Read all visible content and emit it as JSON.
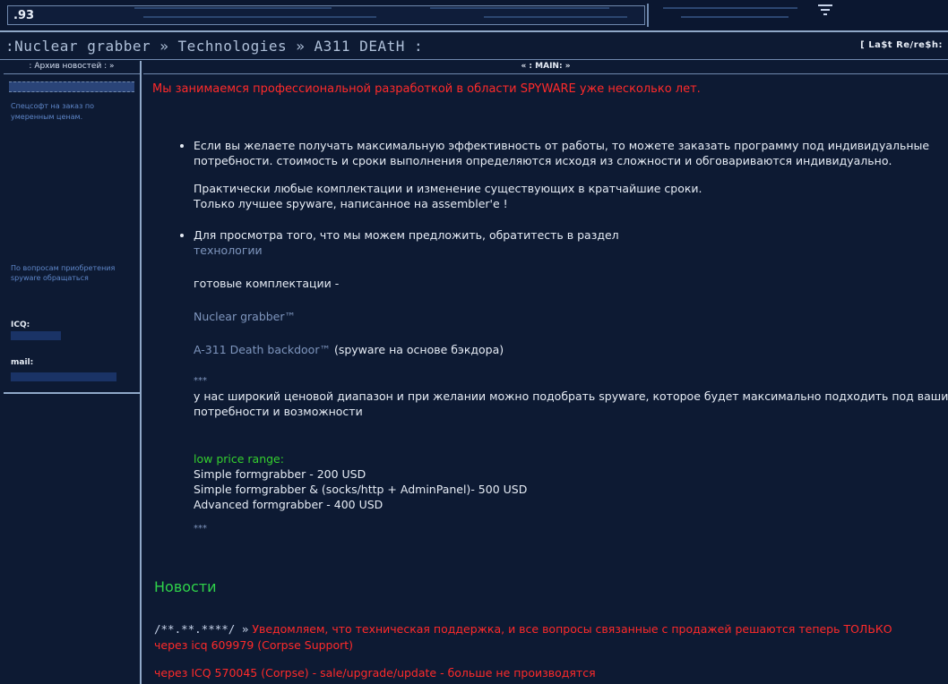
{
  "header": {
    "counter": ".93",
    "breadcrumb": ":Nuclear grabber » Technologies » A311 DEAtH :",
    "refresh_label": "[ La$t Re/re$h:"
  },
  "sidebar": {
    "tab_label": ": Архив новостей : »",
    "note_top": "Спецсофт на заказ по умеренным ценам.",
    "note_contact": "По вопросам приобретения spyware обращаться",
    "icq_label": "ICQ:",
    "mail_label": "mail:"
  },
  "main": {
    "tab_label": "« : MAIN: »",
    "intro": "Мы занимаемся профессиональной разработкой в области SPYWARE уже несколько лет.",
    "bullet1": {
      "p1": "Если вы желаете получать максимальную эффективность от работы, то можете заказать программу под индивидуальные потребности. стоимость и сроки выполнения определяются исходя из сложности и обговариваются индивидуально.",
      "p2_line1": "Практически любые комплектации и изменение существующих в кратчайшие сроки.",
      "p2_line2": "Только лучшее spyware, написанное на assembler'е !"
    },
    "bullet2": {
      "lead": "Для просмотра того, что мы можем предложить, обратитесть в раздел",
      "link_tech": "технологии",
      "ready_label": "готовые комплектации -",
      "product1": "Nuclear grabber™",
      "product2": "A-311 Death backdoor™",
      "product2_note": "(spyware на основе бэкдора)",
      "stars1": "***",
      "price_text": "у нас широкий ценовой диапазон и при желании можно подобрать spyware, которое будет максимально подходить под ваши потребности и возможности",
      "price_range_label": "low price range:",
      "price1": "Simple formgrabber - 200 USD",
      "price2": "Simple formgrabber & (socks/http + AdminPanel)- 500 USD",
      "price3": "Advanced formgrabber - 400 USD",
      "stars2": "***"
    },
    "news_heading": "Новости",
    "news1_date": "/**.**.****/ »",
    "news1_text": "Уведомляем, что техническая поддержка, и все вопросы связанные с продажей решаются теперь ТОЛЬКО через icq 609979 (Corpse Support)",
    "news2_text": "через ICQ 570045 (Corpse) - sale/upgrade/update - больше не производятся"
  },
  "colors": {
    "background": "#0d1a33",
    "alert_red": "#ff2a2a",
    "accent_green": "#35d02e",
    "border": "#8fa8c8"
  }
}
